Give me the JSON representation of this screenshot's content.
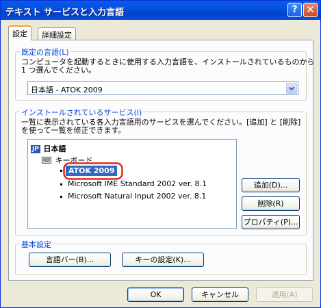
{
  "window": {
    "title": "テキスト サービスと入力言語",
    "help": "?",
    "close": "✕"
  },
  "tabs": [
    {
      "label": "設定"
    },
    {
      "label": "詳細設定"
    }
  ],
  "default_language": {
    "legend": "既定の言語(L)",
    "description": [
      "コンピュータを起動するときに使用する入力言語を、インストールされているものから",
      "1 つ選んでください。"
    ],
    "selected": "日本語 - ATOK 2009"
  },
  "installed_services": {
    "legend": "インストールされているサービス(I)",
    "description": [
      "一覧に表示されている各入力言語用のサービスを選んでください。[追加] と [削除]",
      "を使って一覧を修正できます。"
    ],
    "tree": {
      "language_badge": "JP",
      "language": "日本語",
      "category": "キーボード",
      "services": [
        "ATOK 2009",
        "Microsoft IME Standard 2002 ver. 8.1",
        "Microsoft Natural Input 2002 ver. 8.1"
      ]
    },
    "buttons": {
      "add": "追加(D)...",
      "remove": "削除(R)",
      "properties": "プロパティ(P)..."
    }
  },
  "basic_settings": {
    "legend": "基本設定",
    "buttons": {
      "language_bar": "言語バー(B)...",
      "key_settings": "キーの設定(K)..."
    }
  },
  "footer": {
    "ok": "OK",
    "cancel": "キャンセル",
    "apply": "適用(A)"
  },
  "colors": {
    "title_bar": "#0651de",
    "legend_text": "#0046d5",
    "highlight_circle": "#e4261c"
  }
}
